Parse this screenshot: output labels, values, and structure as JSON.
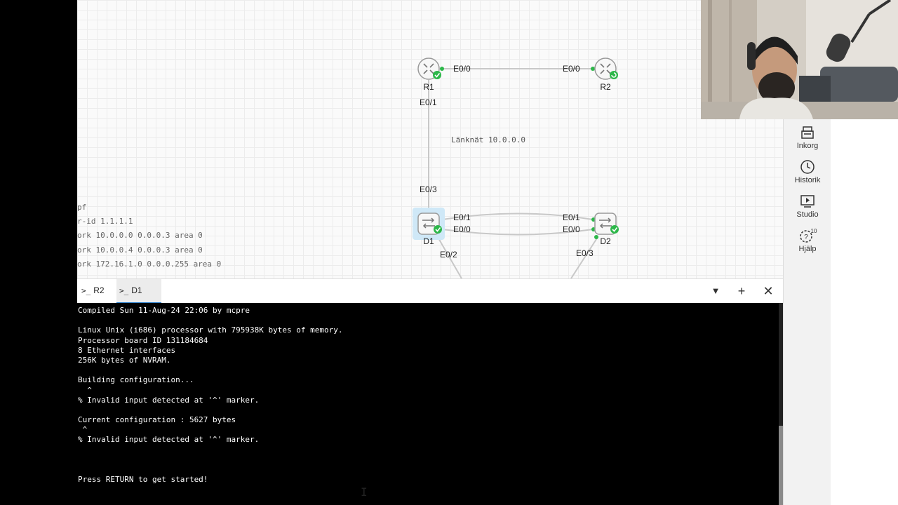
{
  "topology": {
    "routers": [
      {
        "name": "R1"
      },
      {
        "name": "R2"
      },
      {
        "name": "D1"
      },
      {
        "name": "D2"
      }
    ],
    "interface_labels": {
      "r1_e00": "E0/0",
      "r2_e00": "E0/0",
      "r1_e01": "E0/1",
      "d1_e03": "E0/3",
      "d1_e01": "E0/1",
      "d1_e00": "E0/0",
      "d2_e01": "E0/1",
      "d2_e00": "E0/0",
      "d1_e02": "E0/2",
      "d2_e03": "E0/3"
    },
    "network_label": "Länknät 10.0.0.0",
    "link_color": "#c8c8c8",
    "status_color": "#2db84a",
    "selected_color": "#cfe8f7"
  },
  "config_snippet": [
    "pf",
    "r-id 1.1.1.1",
    "ork 10.0.0.0 0.0.0.3 area 0",
    "ork 10.0.0.4 0.0.0.3 area 0",
    "ork 172.16.1.0 0.0.0.255 area 0"
  ],
  "sidebar": [
    {
      "label": "Inkorg",
      "icon": "inbox-icon"
    },
    {
      "label": "Historik",
      "icon": "clock-icon"
    },
    {
      "label": "Studio",
      "icon": "studio-icon"
    },
    {
      "label": "Hjälp",
      "icon": "help-icon",
      "badge": "10"
    }
  ],
  "tabs": [
    {
      "label": "R2",
      "active": false
    },
    {
      "label": "D1",
      "active": true
    }
  ],
  "terminal_lines": [
    "Compiled Sun 11-Aug-24 22:06 by mcpre",
    "",
    "Linux Unix (i686) processor with 795938K bytes of memory.",
    "Processor board ID 131184684",
    "8 Ethernet interfaces",
    "256K bytes of NVRAM.",
    "",
    "Building configuration...",
    "  ^",
    "% Invalid input detected at '^' marker.",
    "",
    "Current configuration : 5627 bytes",
    " ^",
    "% Invalid input detected at '^' marker.",
    "",
    "",
    "",
    "Press RETURN to get started!"
  ]
}
